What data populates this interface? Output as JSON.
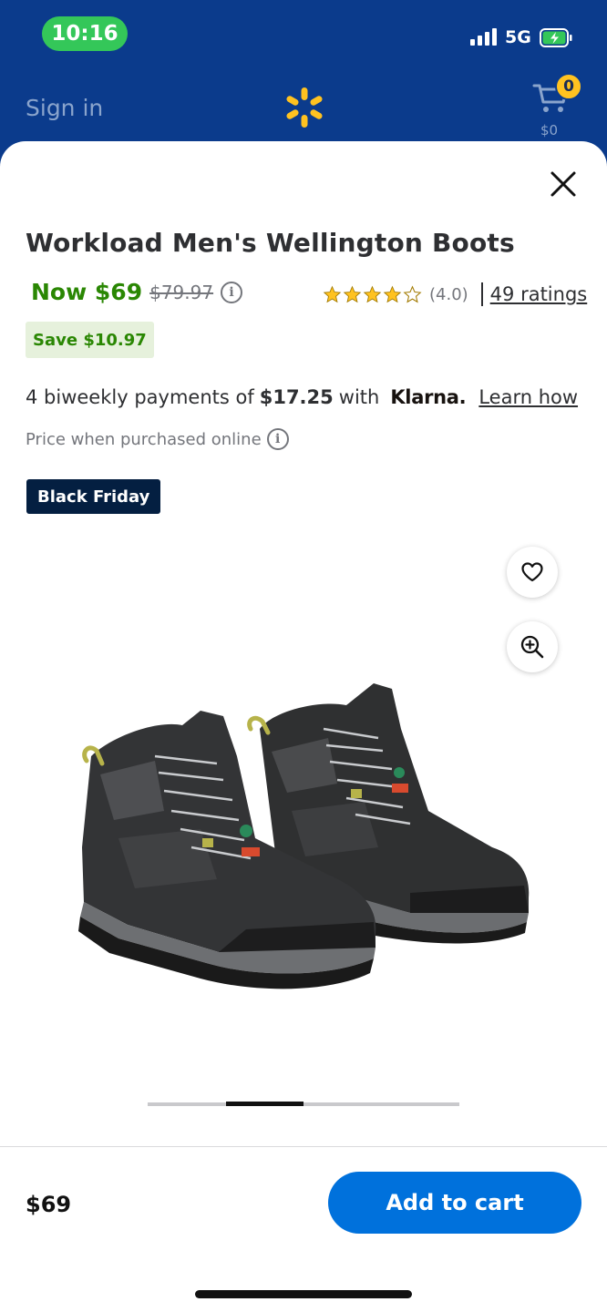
{
  "status_bar": {
    "time": "10:16",
    "network": "5G"
  },
  "header": {
    "sign_in_label": "Sign in",
    "cart_count": "0",
    "cart_total": "$0"
  },
  "product": {
    "title": "Workload Men's Wellington Boots",
    "price_now": "Now $69",
    "price_was": "$79.97",
    "rating_value": "(4.0)",
    "rating_stars": 4.0,
    "rating_count_label": "49 ratings",
    "save_label": "Save $10.97",
    "klarna_prefix": "4 biweekly payments of",
    "klarna_amount": "$17.25",
    "klarna_with": "with",
    "klarna_brand": "Klarna.",
    "learn_how_label": "Learn how",
    "online_note": "Price when purchased online",
    "badge_label": "Black Friday",
    "image_subject": "pair of black hiking work boots"
  },
  "carousel": {
    "total": 4,
    "active": 2
  },
  "footer": {
    "price": "$69",
    "add_to_cart_label": "Add to cart"
  },
  "colors": {
    "header_bg": "#0b3b8c",
    "price_green": "#2a8703",
    "save_bg": "#e6f1dc",
    "badge_bg": "#041f41",
    "primary_blue": "#0071dc",
    "spark_yellow": "#ffc220",
    "status_green": "#34c759"
  },
  "icons": [
    "signal-icon",
    "battery-icon",
    "spark-logo",
    "cart-icon",
    "close-icon",
    "info-icon",
    "star-icon",
    "heart-icon",
    "zoom-icon"
  ]
}
